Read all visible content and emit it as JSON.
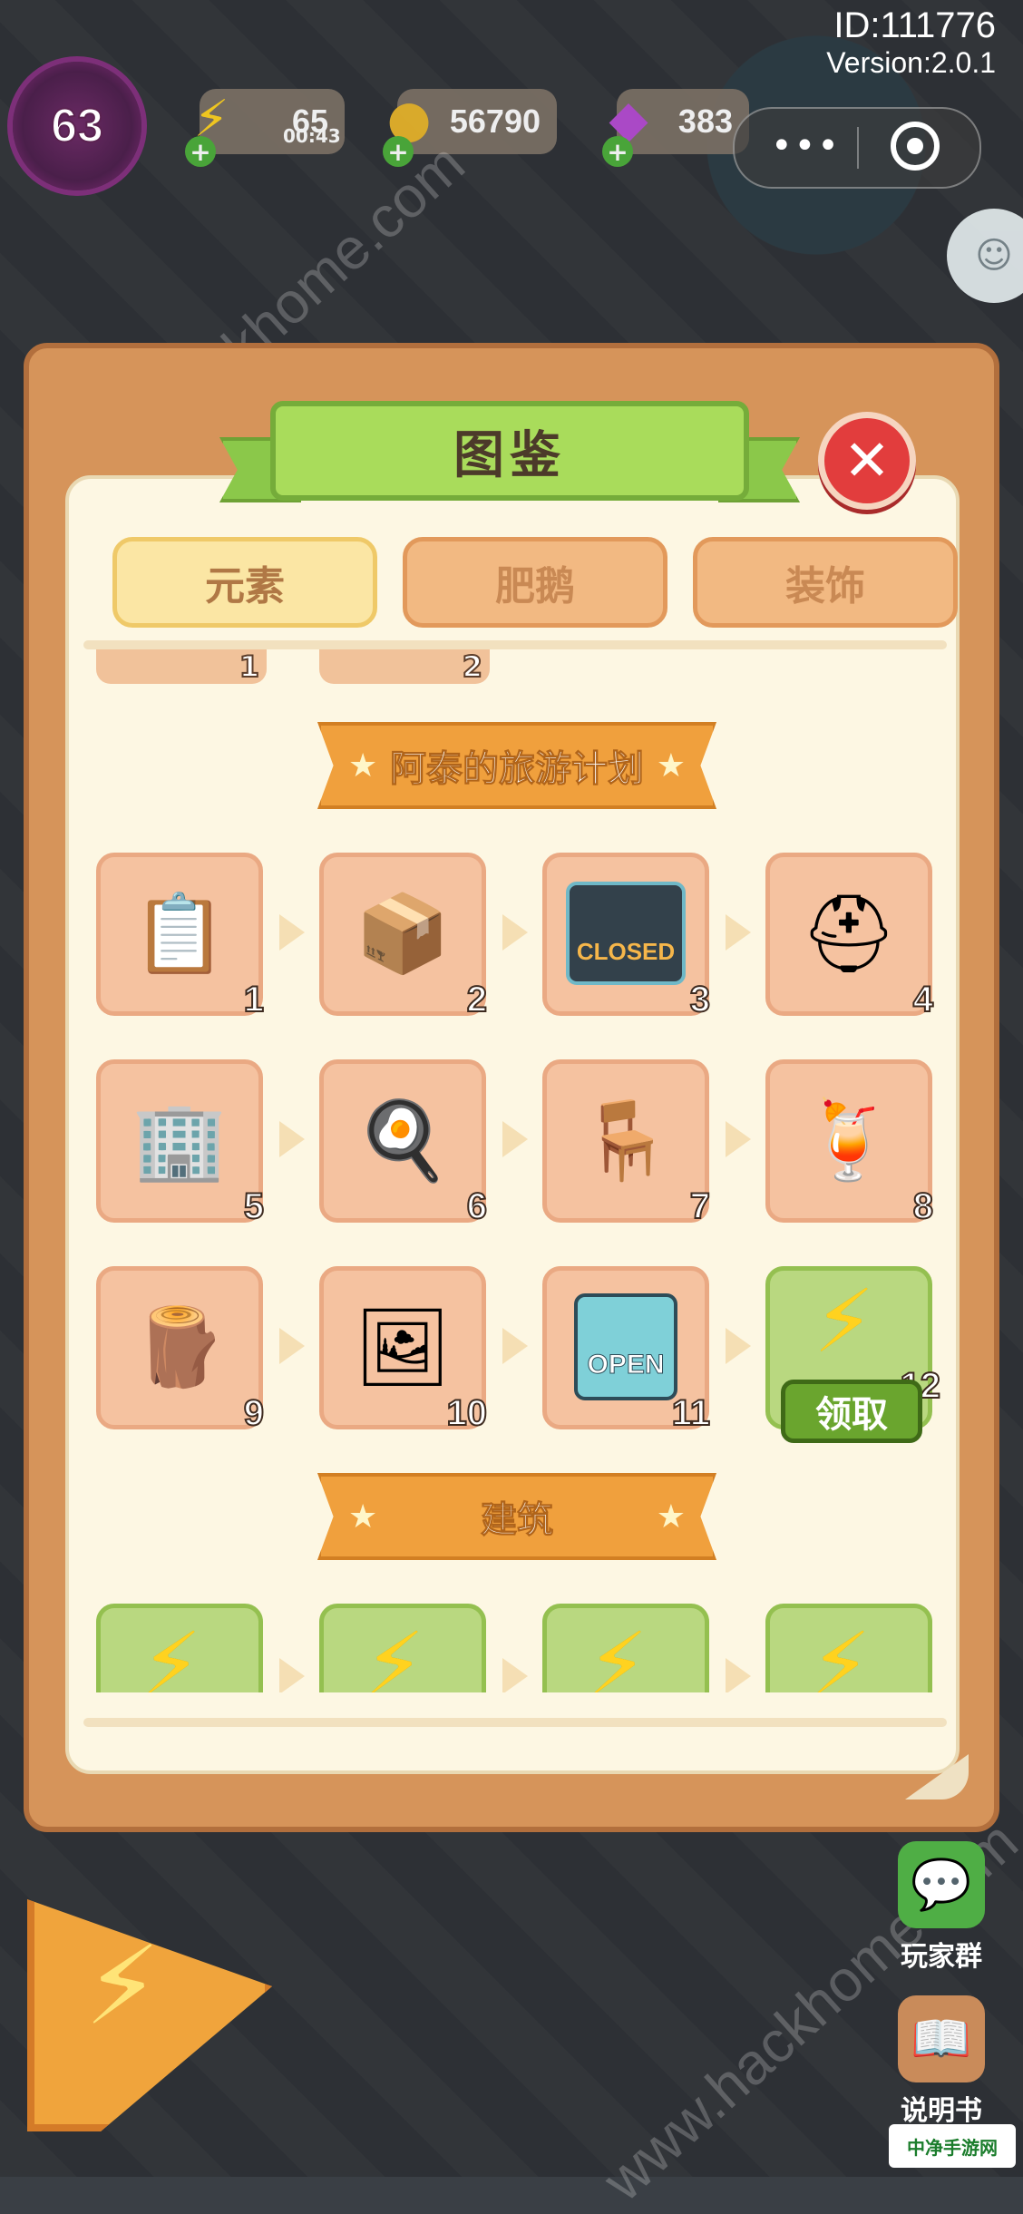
{
  "hud": {
    "level": "63",
    "energy": {
      "value": "65",
      "timer": "00:43"
    },
    "coins": {
      "value": "56790"
    },
    "gems": {
      "value": "383"
    },
    "id": "ID:111776",
    "version": "Version:2.0.1"
  },
  "watermark": "www.hackhome.com",
  "modal": {
    "title": "图鉴",
    "tabs": [
      "元素",
      "肥鹅",
      "装饰"
    ],
    "active_tab": "元素",
    "previous_row_numbers": [
      "1",
      "2"
    ],
    "section_travel": {
      "title": "阿泰的旅游计划",
      "items": [
        {
          "num": "1",
          "icon": "clipboard-icon"
        },
        {
          "num": "2",
          "icon": "boxes-icon"
        },
        {
          "num": "3",
          "icon": "closed-sign-icon",
          "sign_text": "CLOSED"
        },
        {
          "num": "4",
          "icon": "helmet-icon"
        },
        {
          "num": "5",
          "icon": "building-icon"
        },
        {
          "num": "6",
          "icon": "pan-icon"
        },
        {
          "num": "7",
          "icon": "lifeguard-chair-icon"
        },
        {
          "num": "8",
          "icon": "juice-icon"
        },
        {
          "num": "9",
          "icon": "log-pile-icon"
        },
        {
          "num": "10",
          "icon": "photos-icon"
        },
        {
          "num": "11",
          "icon": "open-sign-icon",
          "sign_text": "OPEN"
        },
        {
          "num": "12",
          "icon": "locked-reward-icon",
          "claim_label": "领取"
        }
      ]
    },
    "section_building": {
      "title": "建筑"
    }
  },
  "bottom": {
    "player_group": "玩家群",
    "manual": "说明书",
    "site_logo": "中净手游网"
  }
}
